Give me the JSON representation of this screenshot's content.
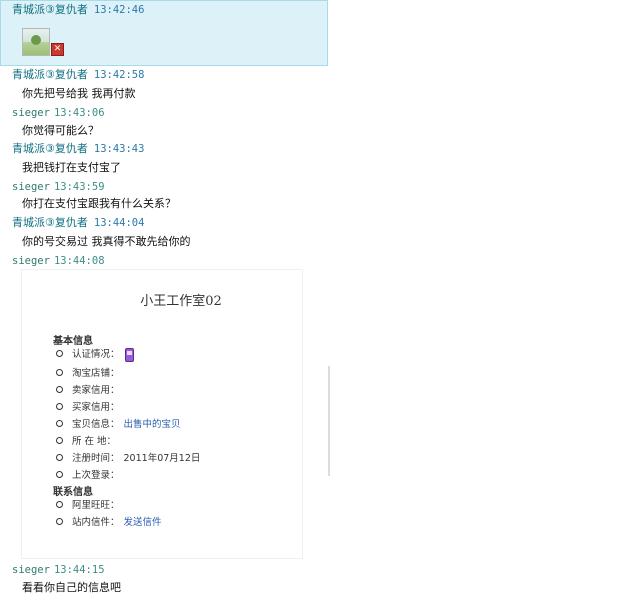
{
  "chat": {
    "messages": [
      {
        "sender": "青城派③复仇者",
        "time": "13:42:46",
        "text": ""
      },
      {
        "sender": "青城派③复仇者",
        "time": "13:42:58",
        "text": "你先把号给我 我再付款"
      },
      {
        "sender": "sieger",
        "time": "13:43:06",
        "text": "你觉得可能么？"
      },
      {
        "sender": "青城派③复仇者",
        "time": "13:43:43",
        "text": "我把钱打在支付宝了"
      },
      {
        "sender": "sieger",
        "time": "13:43:59",
        "text": "你打在支付宝跟我有什么关系？"
      },
      {
        "sender": "青城派③复仇者",
        "time": "13:44:04",
        "text": "你的号交易过 我真得不敢先给你的"
      },
      {
        "sender": "sieger",
        "time": "13:44:08",
        "text": ""
      },
      {
        "sender": "sieger",
        "time": "13:44:15",
        "text": "看看你自己的信息吧"
      }
    ]
  },
  "profile": {
    "title": "小王工作室02",
    "basic_heading": "基本信息",
    "fields": [
      {
        "label": "认证情况：",
        "value": ""
      },
      {
        "label": "淘宝店铺：",
        "value": ""
      },
      {
        "label": "卖家信用：",
        "value": ""
      },
      {
        "label": "买家信用：",
        "value": ""
      },
      {
        "label": "宝贝信息：",
        "value": "出售中的宝贝"
      },
      {
        "label": "所 在 地：",
        "value": ""
      },
      {
        "label": "注册时间：",
        "value": "2011年07月12日"
      },
      {
        "label": "上次登录：",
        "value": ""
      }
    ],
    "contact_heading": "联系信息",
    "contact_fields": [
      {
        "label": "阿里旺旺：",
        "value": ""
      },
      {
        "label": "站内信件：",
        "value": "发送信件"
      }
    ]
  },
  "colors": {
    "highlight_bg": "#ddf2f8",
    "sender_name": "#0f6e80",
    "timestamp": "#2c79a8",
    "link": "#2a5db0"
  },
  "icons": [
    "broken-image-icon",
    "phone-verify-icon"
  ]
}
